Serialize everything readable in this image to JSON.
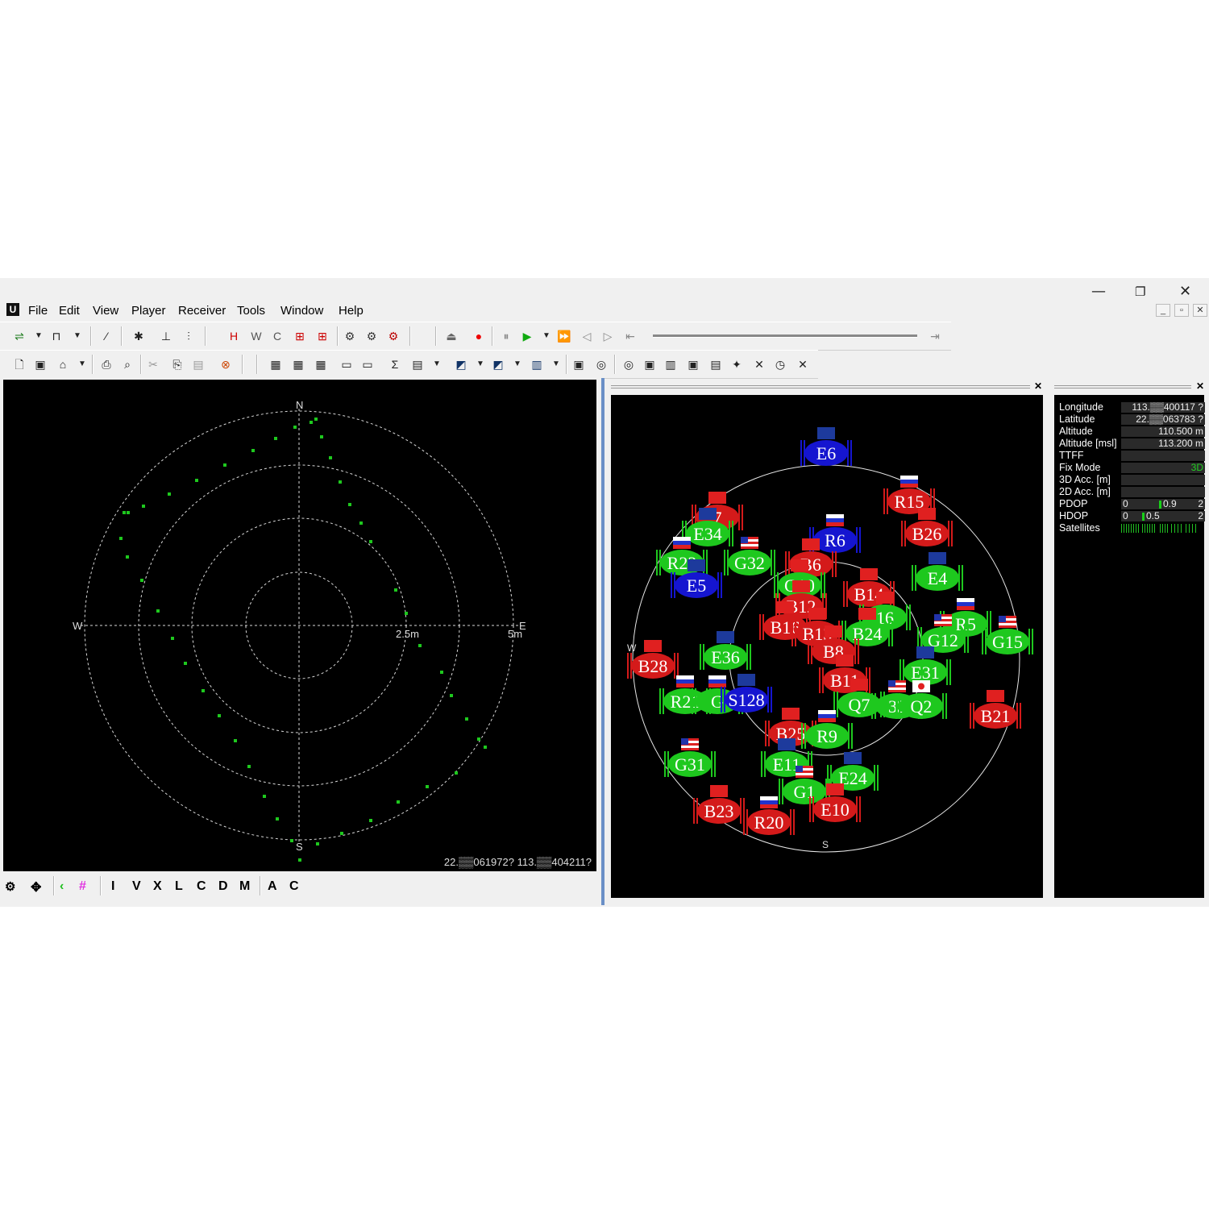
{
  "window": {
    "minimize": "—",
    "restore": "❐",
    "close": "✕",
    "mdi_minimize": "_",
    "mdi_restore": "▫",
    "mdi_close": "✕"
  },
  "menu": [
    "File",
    "Edit",
    "View",
    "Player",
    "Receiver",
    "Tools",
    "Window",
    "Help"
  ],
  "colors": {
    "gps": "#1ec81e",
    "glonass_galileo_blue": "#1515d0",
    "beidou": "#d41a1a",
    "panel_bg": "#000000",
    "frame_accent": "#6a8fc6"
  },
  "left_panel": {
    "compass": {
      "n": "N",
      "s": "S",
      "e": "E",
      "w": "W"
    },
    "ring_labels": [
      "2.5m",
      "5m"
    ],
    "coords": "22.▒▒061972? 113.▒▒404211?"
  },
  "sky_panel": {
    "compass": {
      "w": "W",
      "s": "S"
    },
    "satellites": [
      {
        "id": "E6",
        "color": "blue"
      },
      {
        "id": "R15",
        "color": "red"
      },
      {
        "id": "B26",
        "color": "red"
      },
      {
        "id": "7",
        "color": "red"
      },
      {
        "id": "E34",
        "color": "green"
      },
      {
        "id": "R6",
        "color": "blue"
      },
      {
        "id": "R22",
        "color": "green"
      },
      {
        "id": "G32",
        "color": "green"
      },
      {
        "id": "B6",
        "color": "red"
      },
      {
        "id": "E5",
        "color": "blue"
      },
      {
        "id": "G10",
        "color": "green"
      },
      {
        "id": "E4",
        "color": "green"
      },
      {
        "id": "B14",
        "color": "red"
      },
      {
        "id": "B12",
        "color": "red"
      },
      {
        "id": "16",
        "color": "green"
      },
      {
        "id": "B16",
        "color": "red"
      },
      {
        "id": "B13",
        "color": "red"
      },
      {
        "id": "B24",
        "color": "green"
      },
      {
        "id": "R5",
        "color": "green"
      },
      {
        "id": "G12",
        "color": "green"
      },
      {
        "id": "G15",
        "color": "green"
      },
      {
        "id": "B8",
        "color": "red"
      },
      {
        "id": "B28",
        "color": "red"
      },
      {
        "id": "E36",
        "color": "green"
      },
      {
        "id": "E31",
        "color": "green"
      },
      {
        "id": "B11",
        "color": "red"
      },
      {
        "id": "R21",
        "color": "green"
      },
      {
        "id": "G",
        "color": "green"
      },
      {
        "id": "S128",
        "color": "blue"
      },
      {
        "id": "Q7",
        "color": "green"
      },
      {
        "id": "33",
        "color": "green"
      },
      {
        "id": "Q2",
        "color": "green"
      },
      {
        "id": "B21",
        "color": "red"
      },
      {
        "id": "B25",
        "color": "red"
      },
      {
        "id": "R9",
        "color": "green"
      },
      {
        "id": "G31",
        "color": "green"
      },
      {
        "id": "E11",
        "color": "green"
      },
      {
        "id": "E24",
        "color": "green"
      },
      {
        "id": "G1",
        "color": "green"
      },
      {
        "id": "B23",
        "color": "red"
      },
      {
        "id": "E10",
        "color": "red"
      },
      {
        "id": "R20",
        "color": "red"
      }
    ]
  },
  "info_panel": {
    "rows": [
      {
        "label": "Longitude",
        "value": "113.▒▒400117 ?"
      },
      {
        "label": "Latitude",
        "value": "22.▒▒063783 ?"
      },
      {
        "label": "Altitude",
        "value": "110.500 m"
      },
      {
        "label": "Altitude [msl]",
        "value": "113.200 m"
      },
      {
        "label": "TTFF",
        "value": ""
      },
      {
        "label": "Fix Mode",
        "value": "3D"
      },
      {
        "label": "3D Acc. [m]",
        "value": ""
      },
      {
        "label": "2D Acc. [m]",
        "value": ""
      }
    ],
    "pdop": {
      "label": "PDOP",
      "min": "0",
      "value": "0.9",
      "max": "2",
      "fraction": 0.45
    },
    "hdop": {
      "label": "HDOP",
      "min": "0",
      "value": "0.5",
      "max": "2",
      "fraction": 0.25
    },
    "satellites_label": "Satellites"
  },
  "bottom_toolbar": [
    "I",
    "V",
    "X",
    "L",
    "C",
    "D",
    "M",
    "A",
    "C"
  ]
}
